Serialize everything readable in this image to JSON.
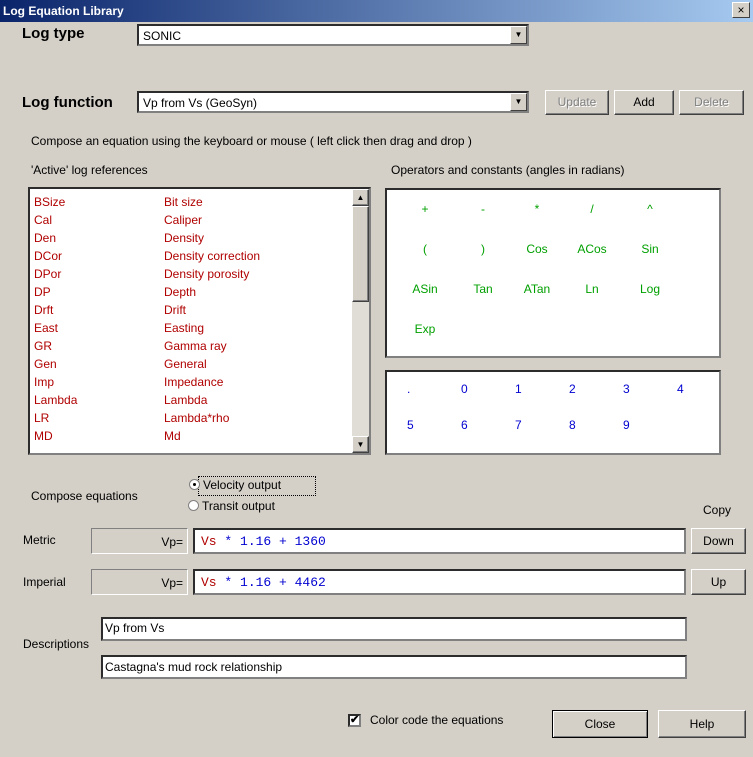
{
  "window": {
    "title": "Log Equation Library",
    "close_glyph": "×"
  },
  "log_type": {
    "label": "Log type",
    "value": "SONIC"
  },
  "log_function": {
    "label": "Log function",
    "value": "Vp from Vs (GeoSyn)"
  },
  "buttons": {
    "update": "Update",
    "add": "Add",
    "delete": "Delete",
    "down": "Down",
    "up": "Up",
    "close": "Close",
    "help": "Help"
  },
  "instructions": "Compose an equation using the keyboard or mouse ( left click then drag and drop )",
  "active_refs": {
    "label": "'Active' log references",
    "items": [
      {
        "code": "BSize",
        "desc": "Bit size"
      },
      {
        "code": "Cal",
        "desc": "Caliper"
      },
      {
        "code": "Den",
        "desc": "Density"
      },
      {
        "code": "DCor",
        "desc": "Density correction"
      },
      {
        "code": "DPor",
        "desc": "Density porosity"
      },
      {
        "code": "DP",
        "desc": "Depth"
      },
      {
        "code": "Drft",
        "desc": "Drift"
      },
      {
        "code": "East",
        "desc": "Easting"
      },
      {
        "code": "GR",
        "desc": "Gamma ray"
      },
      {
        "code": "Gen",
        "desc": "General"
      },
      {
        "code": "Imp",
        "desc": "Impedance"
      },
      {
        "code": "Lambda",
        "desc": "Lambda"
      },
      {
        "code": "LR",
        "desc": "Lambda*rho"
      },
      {
        "code": "MD",
        "desc": "Md"
      }
    ]
  },
  "operators": {
    "label": "Operators and constants (angles in radians)",
    "rows": [
      [
        "+",
        "-",
        "*",
        "/",
        "^"
      ],
      [
        "(",
        ")",
        "Cos",
        "ACos",
        "Sin"
      ],
      [
        "ASin",
        "Tan",
        "ATan",
        "Ln",
        "Log"
      ],
      [
        "Exp"
      ]
    ]
  },
  "digits": {
    "rows": [
      [
        ".",
        "0",
        "1",
        "2",
        "3",
        "4"
      ],
      [
        "5",
        "6",
        "7",
        "8",
        "9"
      ]
    ]
  },
  "compose": {
    "label": "Compose equations",
    "velocity": "Velocity output",
    "transit": "Transit output",
    "copy_label": "Copy"
  },
  "metric": {
    "label": "Metric",
    "lhs": "Vp=",
    "var": "Vs",
    "rest": " * 1.16 + 1360"
  },
  "imperial": {
    "label": "Imperial",
    "lhs": "Vp=",
    "var": "Vs",
    "rest": " * 1.16 + 4462"
  },
  "descriptions": {
    "label": "Descriptions",
    "line1": "Vp from Vs",
    "line2": "Castagna's mud rock relationship"
  },
  "color_code": {
    "label": "Color code the equations",
    "checked": true
  }
}
